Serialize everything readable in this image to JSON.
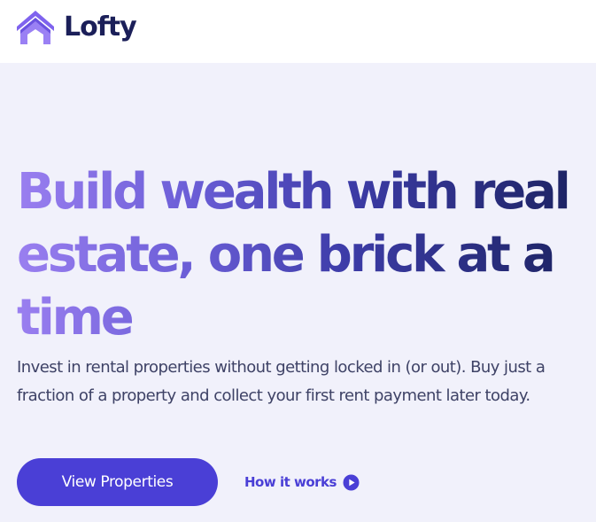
{
  "header": {
    "logo_text": "Lofty",
    "logo_icon": "house-icon",
    "brand_colors": [
      "#8b6ff0",
      "#5b4bd8",
      "#1b1f59"
    ]
  },
  "hero": {
    "headline": "Build wealth with real estate, one brick at a time",
    "subcopy": "Invest in rental properties without getting locked in (or out). Buy just a fraction of a property and collect your first rent payment later today.",
    "primary_cta": "View Properties",
    "secondary_cta": "How it works",
    "secondary_cta_icon": "play-circle-icon",
    "background": "#f1f1fb",
    "accent": "#4a3fd6"
  }
}
